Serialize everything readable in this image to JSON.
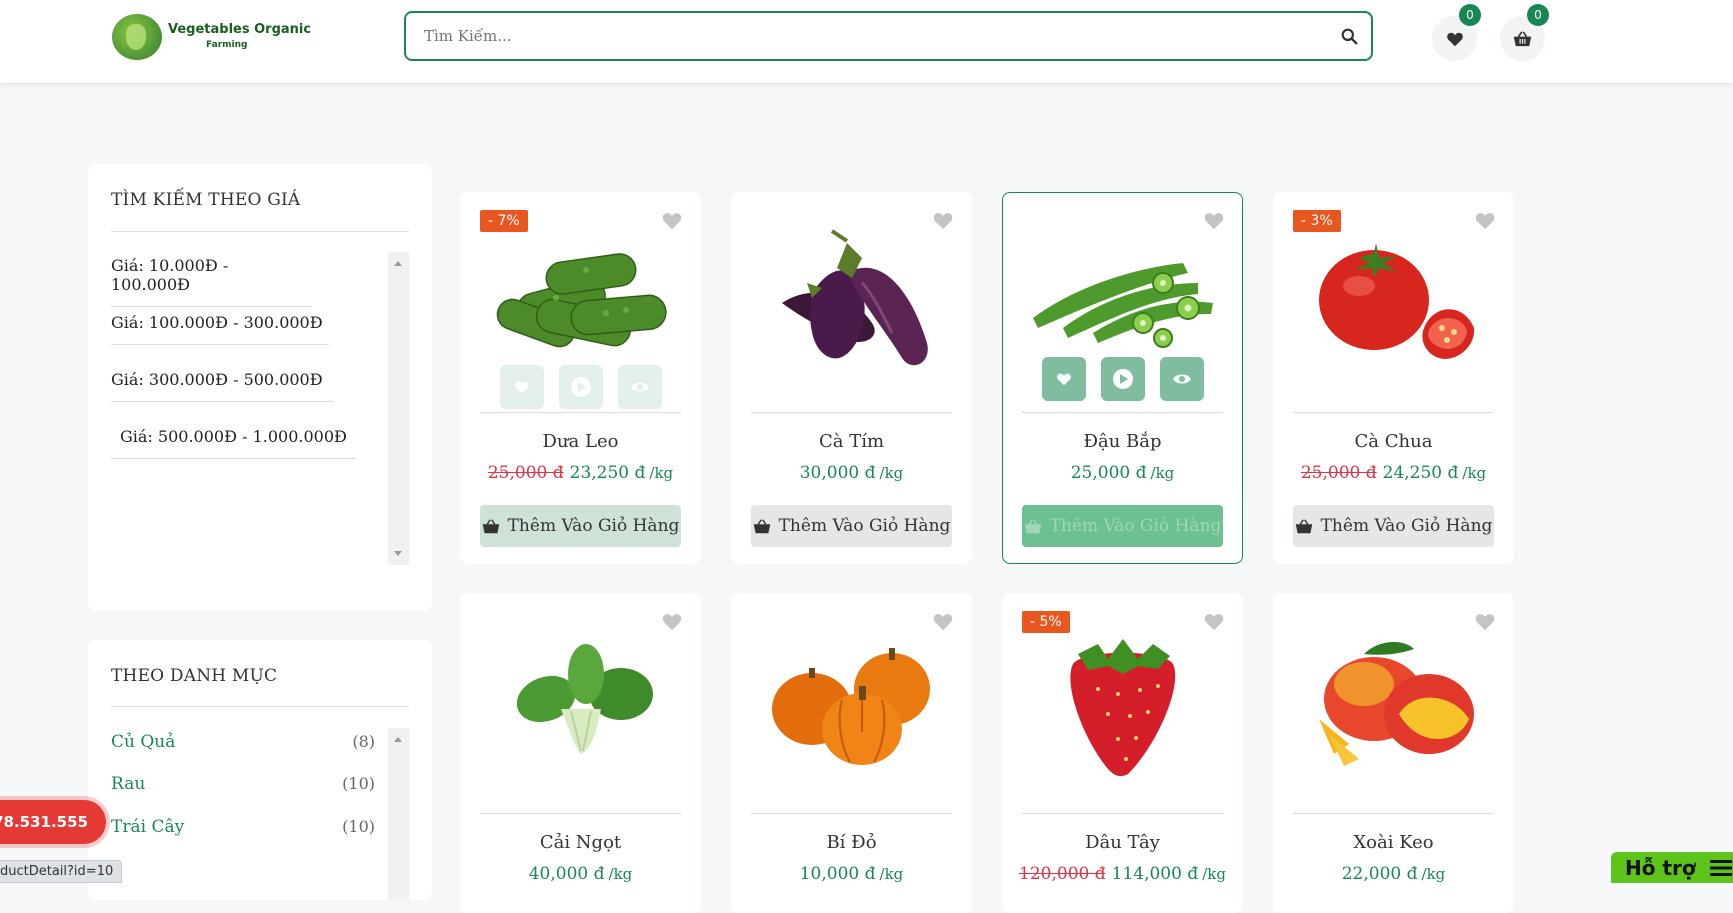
{
  "header": {
    "logo_title": "Vegetables Organic",
    "logo_sub": "Farming",
    "search_placeholder": "Tìm Kiếm...",
    "wishlist_count": "0",
    "cart_count": "0"
  },
  "price_filter": {
    "title": "TÌM KIẾM THEO GIÁ",
    "items": [
      "Giá: 10.000Đ - 100.000Đ",
      "Giá: 100.000Đ - 300.000Đ",
      "Giá: 300.000Đ - 500.000Đ",
      "Giá: 500.000Đ - 1.000.000Đ"
    ]
  },
  "category_filter": {
    "title": "THEO DANH MỤC",
    "items": [
      {
        "name": "Củ Quả",
        "count": "(8)"
      },
      {
        "name": "Rau",
        "count": "(10)"
      },
      {
        "name": "Trái Cây",
        "count": "(10)"
      }
    ]
  },
  "products": [
    {
      "name": "Dưa Leo",
      "discount": "- 7%",
      "old_price": "25,000 đ",
      "price": "23,250 đ",
      "unit": "/kg",
      "image": "cucumbers"
    },
    {
      "name": "Cà Tím",
      "discount": "",
      "old_price": "",
      "price": "30,000 đ",
      "unit": "/kg",
      "image": "eggplants"
    },
    {
      "name": "Đậu Bắp",
      "discount": "",
      "old_price": "",
      "price": "25,000 đ",
      "unit": "/kg",
      "image": "okra"
    },
    {
      "name": "Cà Chua",
      "discount": "- 3%",
      "old_price": "25,000 đ",
      "price": "24,250 đ",
      "unit": "/kg",
      "image": "tomato"
    },
    {
      "name": "Cải Ngọt",
      "discount": "",
      "old_price": "",
      "price": "40,000 đ",
      "unit": "/kg",
      "image": "bok-choy"
    },
    {
      "name": "Bí Đỏ",
      "discount": "",
      "old_price": "",
      "price": "10,000 đ",
      "unit": "/kg",
      "image": "pumpkins"
    },
    {
      "name": "Dâu Tây",
      "discount": "- 5%",
      "old_price": "120,000 đ",
      "price": "114,000 đ",
      "unit": "/kg",
      "image": "strawberry"
    },
    {
      "name": "Xoài Keo",
      "discount": "",
      "old_price": "",
      "price": "22,000 đ",
      "unit": "/kg",
      "image": "mango"
    }
  ],
  "add_to_cart_label": "Thêm Vào Giỏ Hàng",
  "hotline": "78.531.555",
  "status_url": "ductDetail?id=10",
  "support_label": "Hỗ trợ",
  "colors": {
    "accent": "#198754",
    "discount": "#e8571f",
    "old_price": "#dc3545",
    "hotline": "#e53935",
    "support": "#5cc41a"
  }
}
